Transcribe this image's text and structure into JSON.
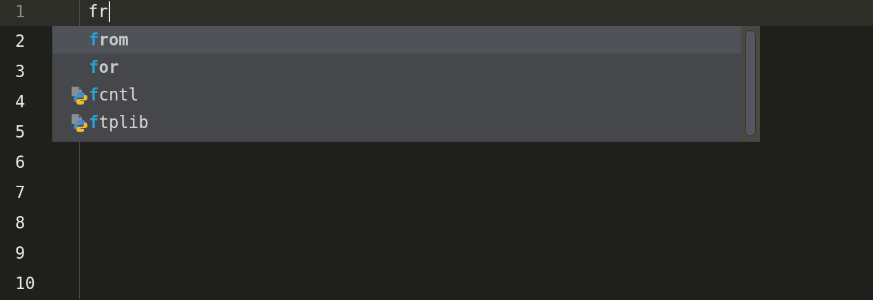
{
  "editor": {
    "lines": [
      {
        "number": "1",
        "current": true,
        "text": "fr"
      },
      {
        "number": "2",
        "current": false
      },
      {
        "number": "3",
        "current": false
      },
      {
        "number": "4",
        "current": false
      },
      {
        "number": "5",
        "current": false
      },
      {
        "number": "6",
        "current": false
      },
      {
        "number": "7",
        "current": false
      },
      {
        "number": "8",
        "current": false
      },
      {
        "number": "9",
        "current": false
      },
      {
        "number": "10",
        "current": false
      }
    ]
  },
  "completion": {
    "items": [
      {
        "kind": "keyword",
        "match": "f",
        "rest": "rom",
        "selected": true
      },
      {
        "kind": "keyword",
        "match": "f",
        "rest": "or",
        "selected": false
      },
      {
        "kind": "module",
        "match": "f",
        "rest": "cntl",
        "selected": false
      },
      {
        "kind": "module",
        "match": "f",
        "rest": "tplib",
        "selected": false
      }
    ]
  }
}
